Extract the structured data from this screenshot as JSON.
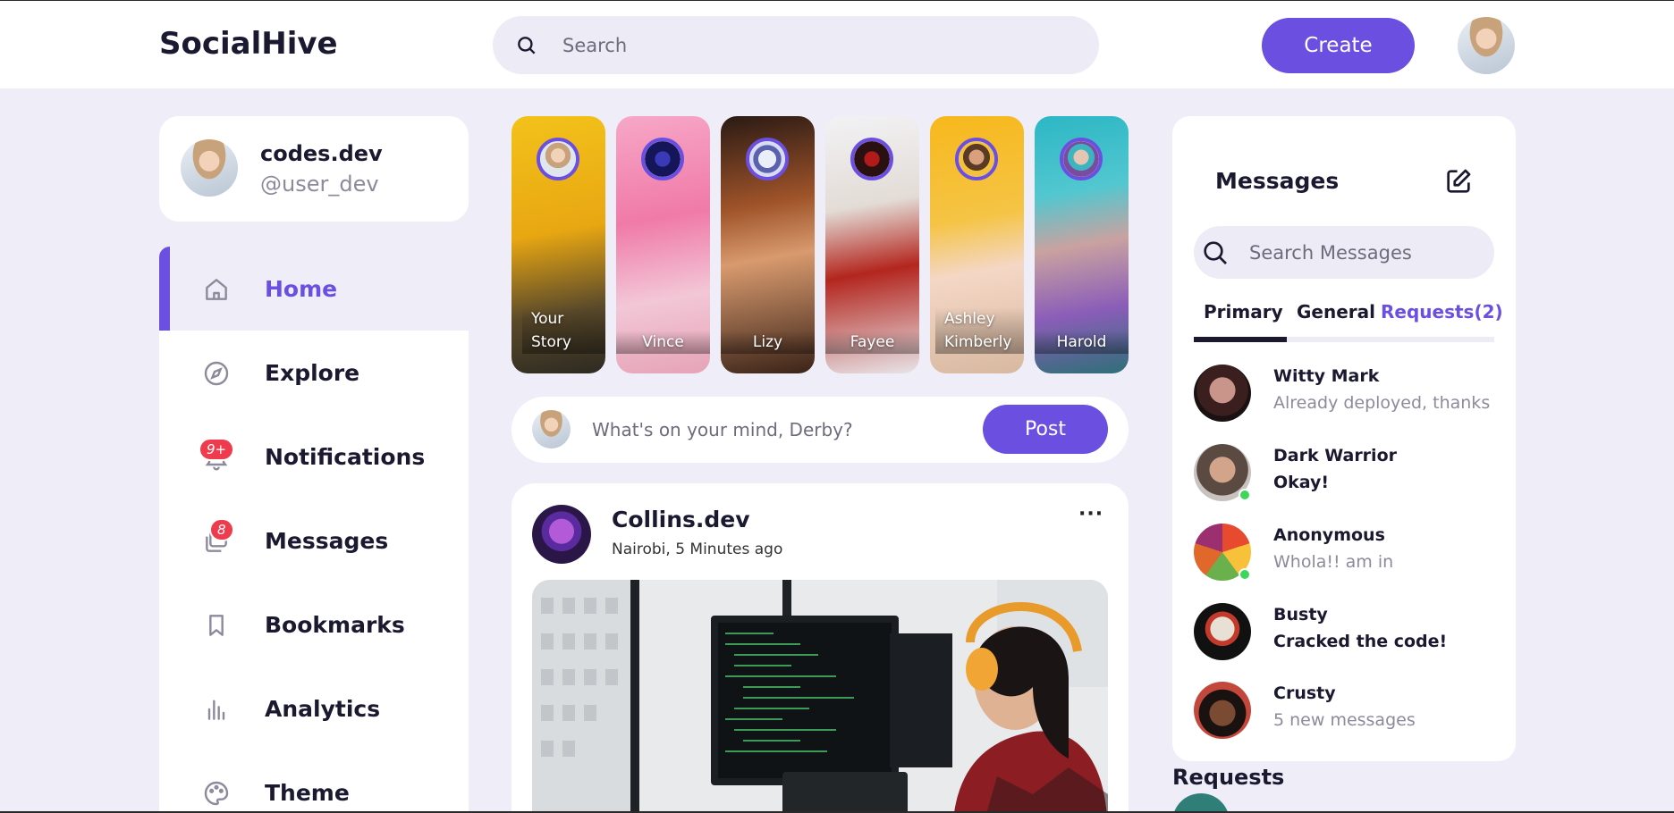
{
  "brand": {
    "name": "SocialHive"
  },
  "navbar": {
    "search_placeholder": "Search",
    "create_label": "Create"
  },
  "profile": {
    "name": "codes.dev",
    "handle": "@user_dev"
  },
  "sidebar": {
    "items": [
      {
        "label": "Home",
        "icon": "home-icon",
        "active": true
      },
      {
        "label": "Explore",
        "icon": "compass-icon"
      },
      {
        "label": "Notifications",
        "icon": "bell-icon",
        "badge": "9+"
      },
      {
        "label": "Messages",
        "icon": "messages-icon",
        "badge": "8"
      },
      {
        "label": "Bookmarks",
        "icon": "bookmark-icon"
      },
      {
        "label": "Analytics",
        "icon": "analytics-icon"
      },
      {
        "label": "Theme",
        "icon": "palette-icon"
      }
    ]
  },
  "stories": [
    {
      "name": "Your Story"
    },
    {
      "name": "Vince"
    },
    {
      "name": "Lizy"
    },
    {
      "name": "Fayee"
    },
    {
      "name": "Ashley Kimberly"
    },
    {
      "name": "Harold"
    }
  ],
  "create_post": {
    "placeholder": "What's on your mind, Derby?",
    "post_label": "Post"
  },
  "feed": {
    "author": "Collins.dev",
    "meta": "Nairobi, 5 Minutes ago",
    "more": "···"
  },
  "messages": {
    "title": "Messages",
    "search_placeholder": "Search Messages",
    "tabs": [
      "Primary",
      "General",
      "Requests(2)"
    ],
    "items": [
      {
        "name": "Witty Mark",
        "text": "Already deployed, thanks",
        "bold": false,
        "online": false
      },
      {
        "name": "Dark Warrior",
        "text": "Okay!",
        "bold": true,
        "online": true
      },
      {
        "name": "Anonymous",
        "text": "Whola!! am in",
        "bold": false,
        "online": true
      },
      {
        "name": "Busty",
        "text": "Cracked the code!",
        "bold": true,
        "online": false
      },
      {
        "name": "Crusty",
        "text": "5 new messages",
        "bold": false,
        "online": false
      }
    ]
  },
  "requests": {
    "title": "Requests"
  },
  "colors": {
    "accent": "#6a4fe0",
    "background": "#efeef8",
    "badge": "#ee3b4d",
    "online": "#3ed65a"
  }
}
